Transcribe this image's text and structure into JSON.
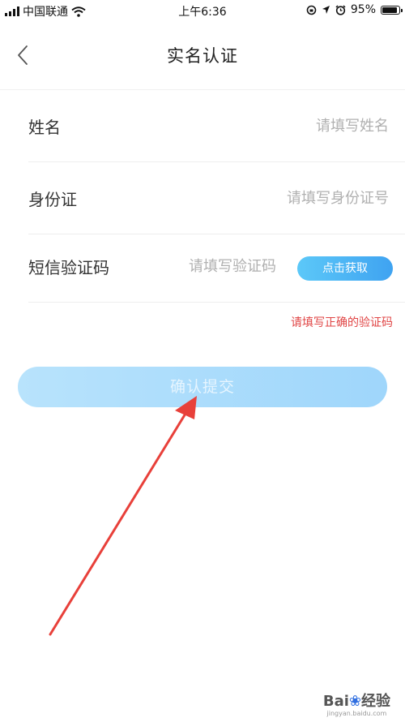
{
  "status_bar": {
    "carrier": "中国联通",
    "time": "上午6:36",
    "battery_percent": "95%",
    "battery_level": 0.95,
    "icons": [
      "signal-icon",
      "wifi-icon",
      "rotation-lock-icon",
      "location-icon",
      "alarm-icon",
      "battery-icon"
    ]
  },
  "nav": {
    "title": "实名认证",
    "back_icon": "chevron-left-icon"
  },
  "form": {
    "name": {
      "label": "姓名",
      "placeholder": "请填写姓名"
    },
    "id_card": {
      "label": "身份证",
      "placeholder": "请填写身份证号"
    },
    "sms_code": {
      "label": "短信验证码",
      "placeholder": "请填写验证码",
      "get_code_label": "点击获取"
    },
    "error_message": "请填写正确的验证码",
    "submit_label": "确认提交"
  },
  "watermark": {
    "logo_text": "Bai",
    "logo_suffix": "经验",
    "url": "jingyan.baidu.com"
  },
  "colors": {
    "accent": "#3fa3f1",
    "submit_disabled": "#a9dcfb",
    "error": "#e04545",
    "annotation_arrow": "#e8403a"
  }
}
